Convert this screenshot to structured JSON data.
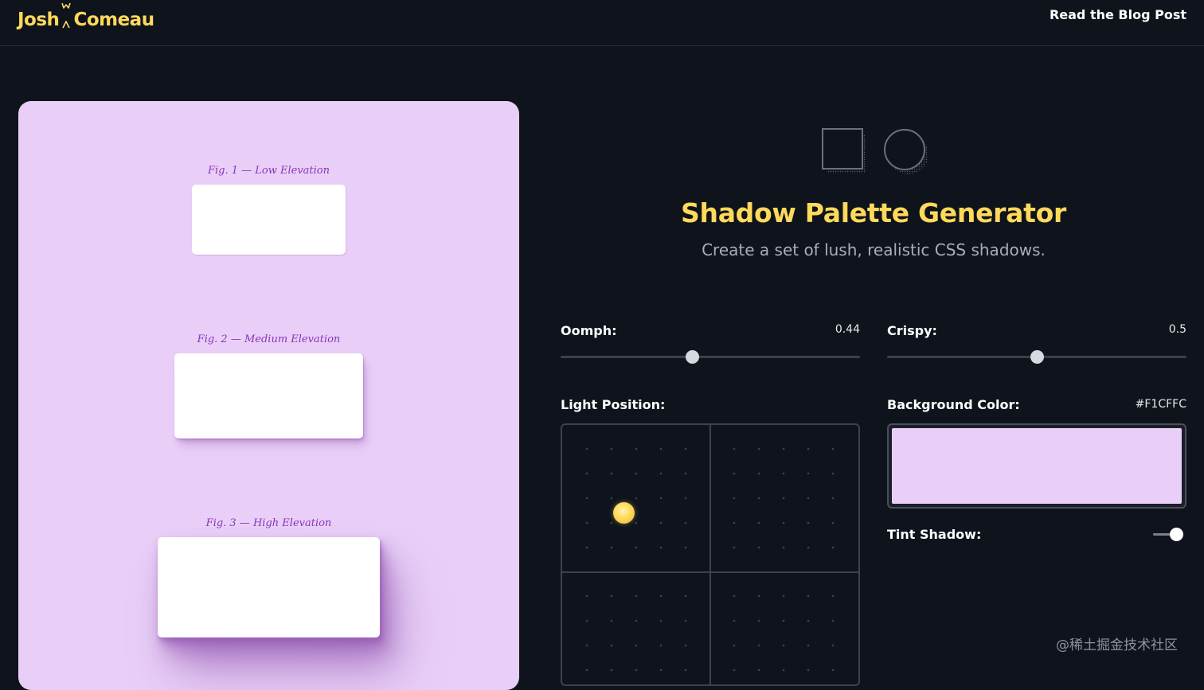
{
  "header": {
    "logo_first": "Josh",
    "logo_last": "Comeau",
    "nav_link": "Read the Blog Post"
  },
  "preview": {
    "background": "#F1CFFC",
    "figures": [
      {
        "caption": "Fig. 1 — Low Elevation"
      },
      {
        "caption": "Fig. 2 — Medium Elevation"
      },
      {
        "caption": "Fig. 3 — High Elevation"
      }
    ]
  },
  "hero": {
    "icons": [
      "square-shadow-icon",
      "circle-shadow-icon"
    ],
    "title": "Shadow Palette Generator",
    "subtitle": "Create a set of lush, realistic CSS shadows."
  },
  "controls": {
    "oomph": {
      "label": "Oomph:",
      "value": "0.44",
      "fraction": 0.44
    },
    "crispy": {
      "label": "Crispy:",
      "value": "0.5",
      "fraction": 0.5
    },
    "light_position": {
      "label": "Light Position:"
    },
    "background_color": {
      "label": "Background Color:",
      "value": "#F1CFFC"
    },
    "tint_shadow": {
      "label": "Tint Shadow:",
      "enabled": true
    }
  },
  "watermark": "@稀土掘金技术社区",
  "colors": {
    "page_bg": "#0f141c",
    "accent": "#ffd95a",
    "fig_caption": "#8a35b8"
  }
}
